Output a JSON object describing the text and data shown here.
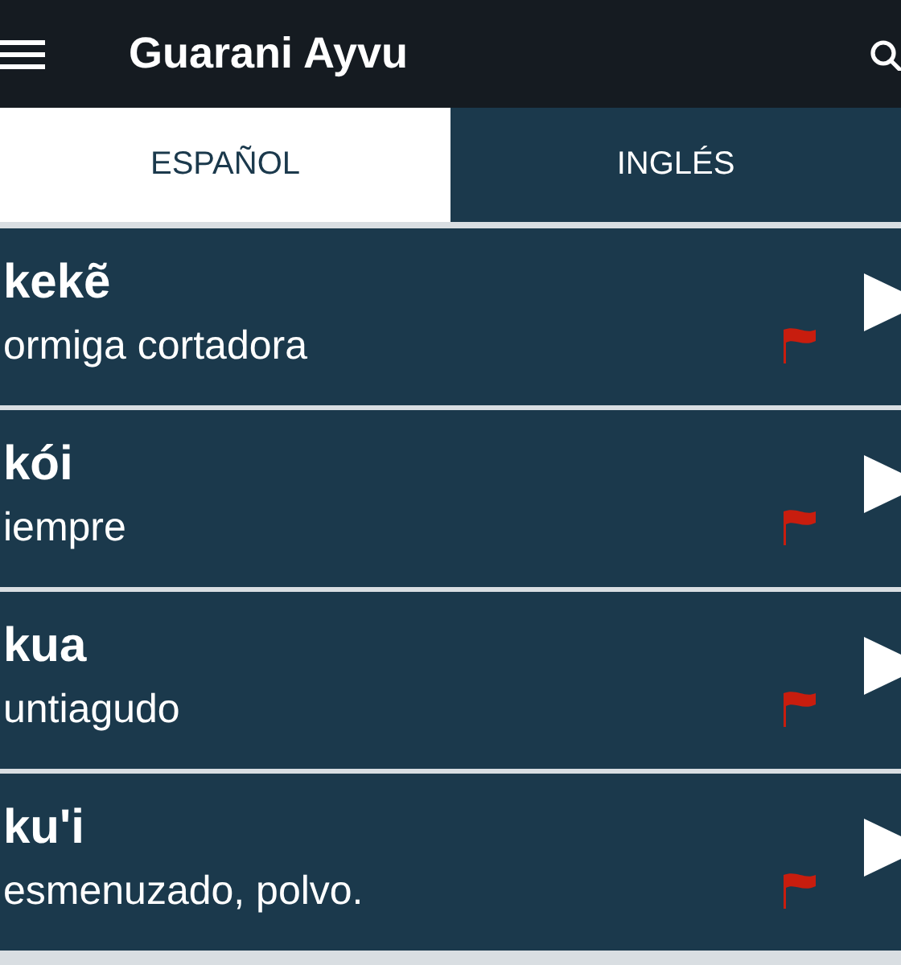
{
  "app_bar": {
    "title": "Guarani Ayvu"
  },
  "tabs": [
    {
      "label": "ESPAÑOL",
      "selected": true
    },
    {
      "label": "INGLÉS",
      "selected": false
    }
  ],
  "entries": [
    {
      "word": "kekẽ",
      "meaning": "ormiga cortadora"
    },
    {
      "word": "kói",
      "meaning": "iempre"
    },
    {
      "word": "kua",
      "meaning": "untiagudo"
    },
    {
      "word": "ku'i",
      "meaning": "esmenuzado, polvo."
    }
  ]
}
